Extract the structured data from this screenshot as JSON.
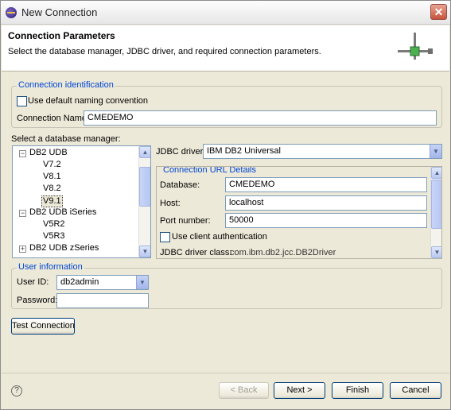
{
  "window": {
    "title": "New Connection"
  },
  "header": {
    "title": "Connection Parameters",
    "description": "Select the database manager, JDBC driver, and required connection parameters."
  },
  "identification": {
    "legend": "Connection identification",
    "use_default_label": "Use default naming convention",
    "use_default_checked": false,
    "name_label": "Connection Name:",
    "name_value": "CMEDEMO"
  },
  "db_manager": {
    "label": "Select a database manager:",
    "tree": [
      {
        "label": "DB2 UDB",
        "expanded": true,
        "level": 0
      },
      {
        "label": "V7.2",
        "level": 1
      },
      {
        "label": "V8.1",
        "level": 1
      },
      {
        "label": "V8.2",
        "level": 1
      },
      {
        "label": "V9.1",
        "level": 1,
        "selected": true
      },
      {
        "label": "DB2 UDB iSeries",
        "expanded": true,
        "level": 0
      },
      {
        "label": "V5R2",
        "level": 1
      },
      {
        "label": "V5R3",
        "level": 1
      },
      {
        "label": "DB2 UDB zSeries",
        "expanded": false,
        "level": 0
      }
    ]
  },
  "jdbc": {
    "driver_label": "JDBC driver:",
    "driver_value": "IBM DB2 Universal",
    "url_legend": "Connection URL Details",
    "database_label": "Database:",
    "database_value": "CMEDEMO",
    "host_label": "Host:",
    "host_value": "localhost",
    "port_label": "Port number:",
    "port_value": "50000",
    "client_auth_label": "Use client authentication",
    "client_auth_checked": false,
    "class_label": "JDBC driver class:",
    "class_value": "com.ibm.db2.jcc.DB2Driver"
  },
  "user": {
    "legend": "User information",
    "userid_label": "User ID:",
    "userid_value": "db2admin",
    "password_label": "Password:",
    "password_value": ""
  },
  "buttons": {
    "test": "Test Connection",
    "back": "< Back",
    "next": "Next >",
    "finish": "Finish",
    "cancel": "Cancel"
  },
  "icons": {
    "app": "eclipse-icon",
    "close": "close-icon",
    "banner": "connection-icon",
    "help": "help-icon"
  }
}
